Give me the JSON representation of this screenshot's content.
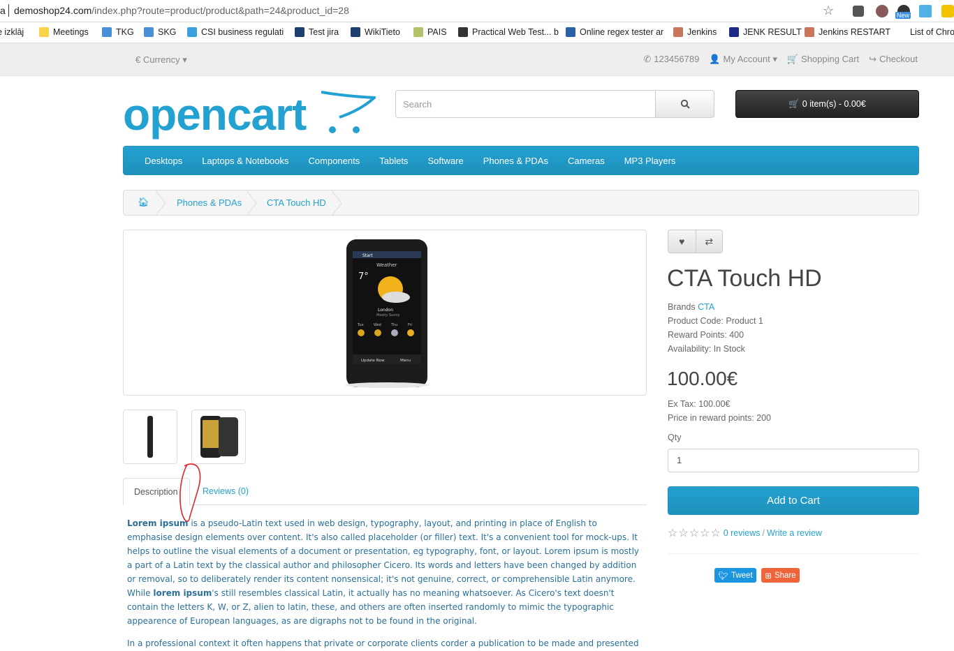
{
  "browser": {
    "url_host": "demoshop24.com",
    "url_path": "/index.php?route=product/product&path=24&product_id=28",
    "left_cut_text": "a",
    "ext_badge": "New",
    "bookmarks": [
      {
        "label": "e izklāj",
        "color": "#ffffff"
      },
      {
        "label": "Meetings",
        "color": "#f9d34a"
      },
      {
        "label": "TKG",
        "color": "#4a90d9"
      },
      {
        "label": "SKG",
        "color": "#4a90d9"
      },
      {
        "label": "CSI business regulati",
        "color": "#3aa0e0"
      },
      {
        "label": "Test jira",
        "color": "#1d3f70"
      },
      {
        "label": "WikiTieto",
        "color": "#1d3f70"
      },
      {
        "label": "PAIS",
        "color": "#b5c26a"
      },
      {
        "label": "Practical Web Test... b",
        "color": "#333333"
      },
      {
        "label": "Online regex tester ar",
        "color": "#2b5fa6"
      },
      {
        "label": "Jenkins",
        "color": "#c9765a"
      },
      {
        "label": "JENK RESULT",
        "color": "#1d2a8a"
      },
      {
        "label": "Jenkins RESTART",
        "color": "#c9765a"
      },
      {
        "label": "List of Chron",
        "color": "#ffffff"
      }
    ]
  },
  "topnav": {
    "currency": "€ Currency",
    "phone": "123456789",
    "account": "My Account",
    "cart": "Shopping Cart",
    "checkout": "Checkout"
  },
  "header": {
    "logo_text": "opencart",
    "search_placeholder": "Search",
    "cart_summary": "0 item(s) - 0.00€"
  },
  "menu": [
    "Desktops",
    "Laptops & Notebooks",
    "Components",
    "Tablets",
    "Software",
    "Phones & PDAs",
    "Cameras",
    "MP3 Players"
  ],
  "breadcrumb": [
    "Phones & PDAs",
    "CTA Touch HD"
  ],
  "product": {
    "name": "CTA Touch HD",
    "brand_label": "Brands",
    "brand": "CTA",
    "code": "Product Code: Product 1",
    "reward": "Reward Points: 400",
    "availability": "Availability: In Stock",
    "price": "100.00€",
    "ex_tax": "Ex Tax: 100.00€",
    "price_points": "Price in reward points: 200",
    "qty_label": "Qty",
    "qty_value": "1",
    "add_to_cart": "Add to Cart",
    "reviews_link": "0 reviews",
    "write_review": "Write a review",
    "tweet": "Tweet",
    "share": "Share",
    "rating": 0,
    "rating_max": 5,
    "screen_texts": {
      "start": "Start",
      "weather": "Weather",
      "temp": "7°",
      "city": "London",
      "sub": "Mostly Sunny",
      "update": "Update Now",
      "menu": "Menu",
      "days": [
        "Tue",
        "Wed",
        "Thu",
        "Fri"
      ]
    }
  },
  "tabs": {
    "description": "Description",
    "reviews": "Reviews (0)"
  },
  "description": {
    "lead_bold": "Lorem ipsum",
    "p1_a": " is a pseudo-Latin text used in web design, typography, layout, and printing in place of English to emphasise design elements over content. It's also called placeholder (or filler) text. It's a convenient tool for mock-ups. It helps to outline the visual elements of a document or presentation, eg typography, font, or layout. Lorem ipsum is mostly a part of a Latin text by the classical author and philosopher Cicero. Its words and letters have been changed by addition or removal, so to deliberately render its content nonsensical; it's not genuine, correct, or comprehensible Latin anymore. While ",
    "mid_bold": "lorem ipsum",
    "p1_b": "'s still resembles classical Latin, it actually has no meaning whatsoever. As Cicero's text doesn't contain the letters K, W, or Z, alien to latin, these, and others are often inserted randomly to mimic the typographic appearence of European languages, as are digraphs not to be found in the original.",
    "p2": "In a professional context it often happens that private or corporate clients corder a publication to be made and presented"
  },
  "colors": {
    "accent": "#23a1d1",
    "text": "#666666",
    "annotation": "#e0242a"
  }
}
